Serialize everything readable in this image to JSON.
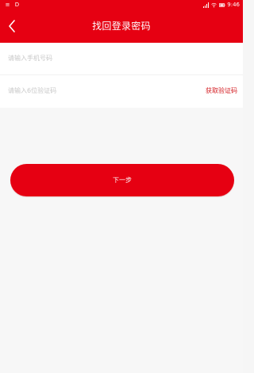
{
  "status_bar": {
    "time": "9:46",
    "left_icons": [
      "notification-icon",
      "d-icon"
    ],
    "right_icons": [
      "signal-icon",
      "wifi-icon",
      "battery-icon"
    ]
  },
  "header": {
    "title": "找回登录密码",
    "back_icon": "chevron-left-icon"
  },
  "form": {
    "phone": {
      "value": "",
      "placeholder": "请输入手机号码"
    },
    "verification": {
      "value": "",
      "placeholder": "请输入6位验证码",
      "button_label": "获取验证码"
    }
  },
  "actions": {
    "next_label": "下一步"
  },
  "colors": {
    "primary": "#e60012",
    "link": "#d41f24",
    "background": "#f7f7f7",
    "surface": "#ffffff",
    "placeholder": "#c8c8c8"
  }
}
